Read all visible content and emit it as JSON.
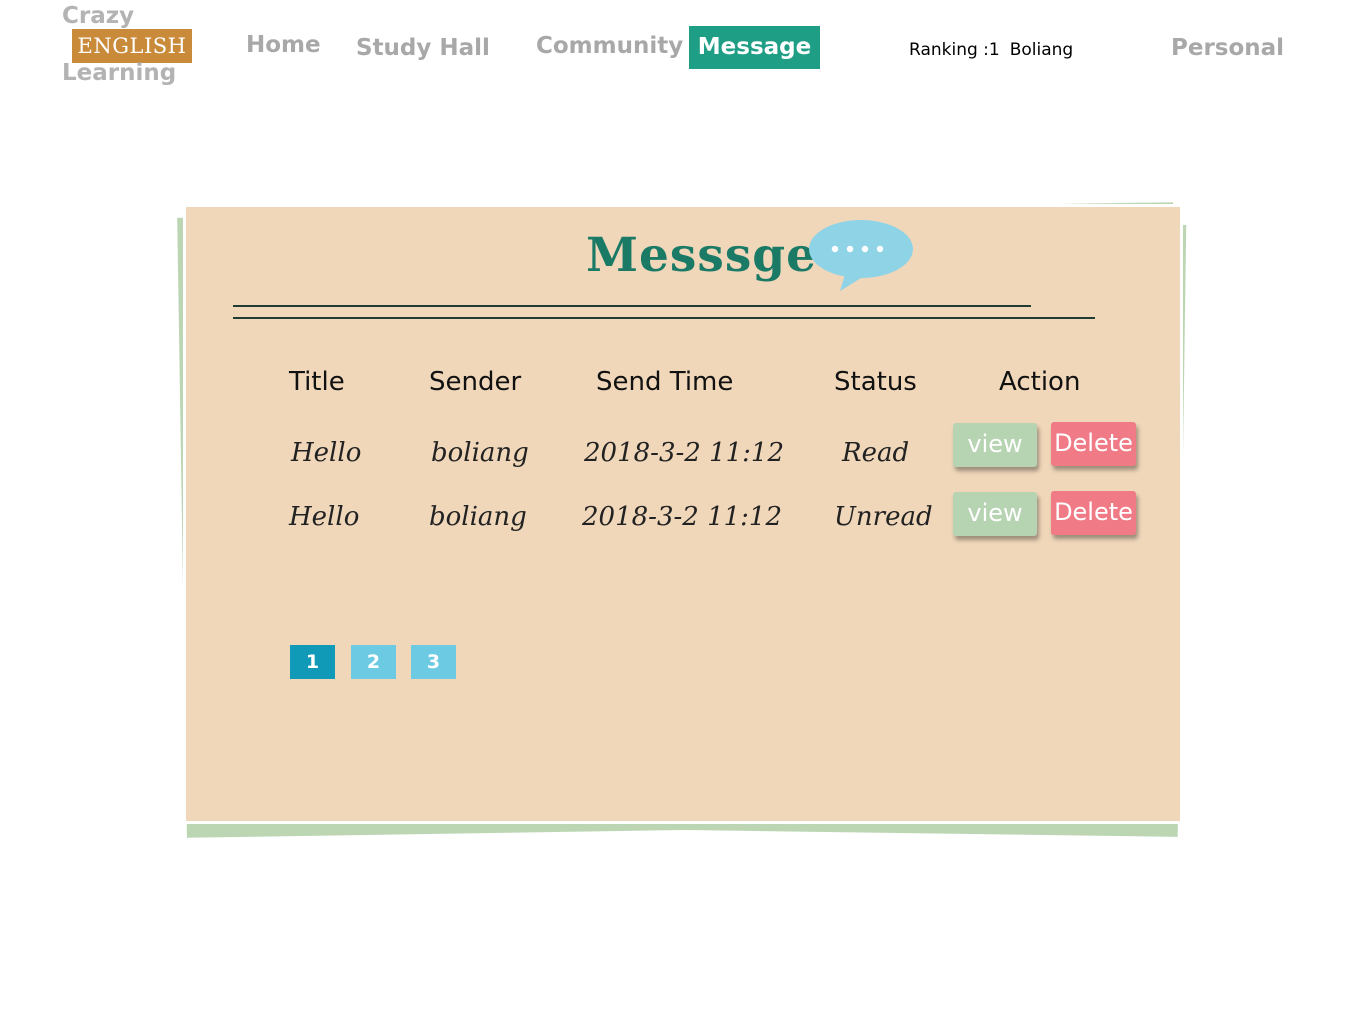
{
  "logo": {
    "top": "Crazy",
    "middle": "ENGLISH",
    "bottom": "Learning"
  },
  "nav": {
    "home": "Home",
    "study_hall": "Study Hall",
    "community": "Community",
    "message": "Message",
    "ranking_label": "Ranking :1",
    "user_name": "Boliang",
    "personal": "Personal"
  },
  "card": {
    "title": "Messsge"
  },
  "table": {
    "headers": [
      "Title",
      "Sender",
      "Send Time",
      "Status",
      "Action"
    ],
    "rows": [
      {
        "title": "Hello",
        "sender": "boliang",
        "send_time": "2018-3-2 11:12",
        "status": "Read",
        "view_label": "view",
        "delete_label": "Delete"
      },
      {
        "title": "Hello",
        "sender": "boliang",
        "send_time": "2018-3-2 11:12",
        "status": "Unread",
        "view_label": "view",
        "delete_label": "Delete"
      }
    ]
  },
  "pagination": {
    "pages": [
      "1",
      "2",
      "3"
    ],
    "current": "1"
  },
  "colors": {
    "nav_active": "#1f9e86",
    "logo_badge": "#c98a3a",
    "card_bg": "#f0d7ba",
    "title": "#1a7a66",
    "view_button": "#b6d3b2",
    "delete_button": "#f07b86",
    "page_active": "#1199b8",
    "page_inactive": "#6ccbe2",
    "bubble": "#8fd3e6"
  },
  "icons": {
    "bubble": "speech-bubble-icon"
  }
}
